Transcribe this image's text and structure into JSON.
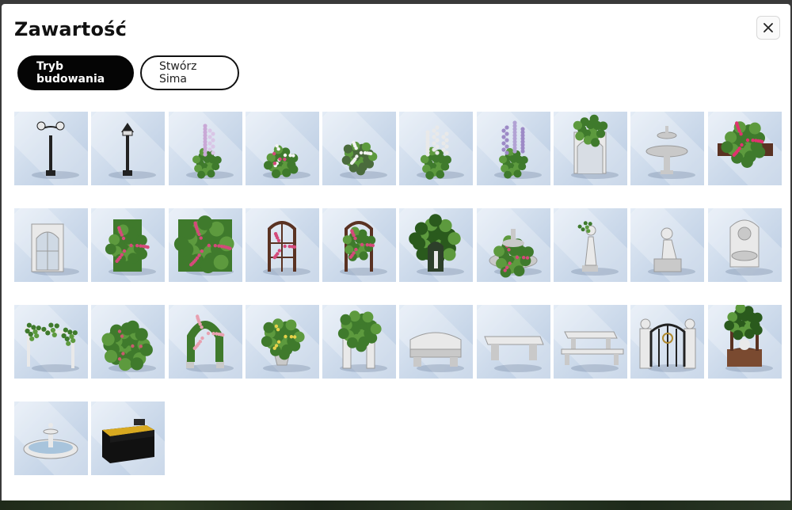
{
  "dialog": {
    "title": "Zawartość",
    "close_icon": "close-icon"
  },
  "tabs": [
    {
      "label": "Tryb budowania",
      "active": true
    },
    {
      "label": "Stwórz Sima",
      "active": false
    }
  ],
  "items": [
    {
      "icon": "double-lamp-post-icon"
    },
    {
      "icon": "lantern-post-icon"
    },
    {
      "icon": "foxglove-plant-icon"
    },
    {
      "icon": "flower-patch-icon"
    },
    {
      "icon": "white-bush-icon"
    },
    {
      "icon": "lupine-plant-icon"
    },
    {
      "icon": "lavender-plant-icon"
    },
    {
      "icon": "ivy-gazebo-arch-icon"
    },
    {
      "icon": "stone-fountain-icon"
    },
    {
      "icon": "pink-flower-box-icon"
    },
    {
      "icon": "arched-window-icon"
    },
    {
      "icon": "rose-hedge-narrow-icon"
    },
    {
      "icon": "rose-hedge-wide-icon"
    },
    {
      "icon": "wooden-trellis-icon"
    },
    {
      "icon": "rose-trellis-icon"
    },
    {
      "icon": "ivy-arch-statue-icon"
    },
    {
      "icon": "tiered-fountain-planter-icon"
    },
    {
      "icon": "woman-statue-icon"
    },
    {
      "icon": "seated-statue-icon"
    },
    {
      "icon": "lion-wall-fountain-icon"
    },
    {
      "icon": "vine-pergola-icon"
    },
    {
      "icon": "round-bush-icon"
    },
    {
      "icon": "rose-arch-icon"
    },
    {
      "icon": "flower-urn-icon"
    },
    {
      "icon": "ivy-stone-arch-icon"
    },
    {
      "icon": "stone-bench-icon"
    },
    {
      "icon": "simple-stone-bench-icon"
    },
    {
      "icon": "picnic-table-icon"
    },
    {
      "icon": "iron-gate-icon"
    },
    {
      "icon": "wishing-well-icon"
    },
    {
      "icon": "garden-fountain-pool-icon"
    },
    {
      "icon": "chest-icon"
    }
  ]
}
